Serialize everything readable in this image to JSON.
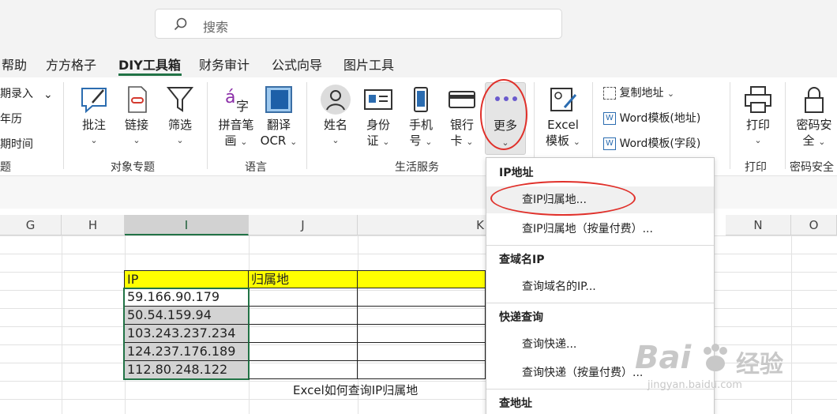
{
  "search": {
    "placeholder": "搜索"
  },
  "tabs": [
    {
      "label": "帮助"
    },
    {
      "label": "方方格子"
    },
    {
      "label": "DIY工具箱"
    },
    {
      "label": "财务审计"
    },
    {
      "label": "公式向导"
    },
    {
      "label": "图片工具"
    }
  ],
  "active_tab": "DIY工具箱",
  "ribbon": {
    "partial_items": [
      "期录入",
      "年历",
      "期时间"
    ],
    "partial_group": "题",
    "btn_comment": "批注",
    "btn_link": "链接",
    "btn_filter": "筛选",
    "group_object": "对象专题",
    "btn_pinyin_1": "拼音笔",
    "btn_pinyin_2": "画",
    "btn_translate_1": "翻译",
    "btn_translate_2": "OCR",
    "group_language": "语言",
    "btn_name": "姓名",
    "btn_id_1": "身份",
    "btn_id_2": "证",
    "btn_phone_1": "手机",
    "btn_phone_2": "号",
    "btn_bank_1": "银行",
    "btn_bank_2": "卡",
    "btn_more": "更多",
    "group_life": "生活服务",
    "btn_excel_1": "Excel",
    "btn_excel_2": "模板",
    "copy_address": "复制地址",
    "word_tpl_address": "Word模板(地址)",
    "word_tpl_field": "Word模板(字段)",
    "btn_print": "打印",
    "group_print": "打印",
    "btn_password_1": "密码安",
    "btn_password_2": "全",
    "group_password": "密码安全"
  },
  "columns": [
    "G",
    "H",
    "I",
    "J",
    "K",
    "N",
    "O"
  ],
  "table": {
    "header_ip": "IP",
    "header_location": "归属地",
    "ips": [
      "59.166.90.179",
      "50.54.159.94",
      "103.243.237.234",
      "124.237.176.189",
      "112.80.248.122"
    ]
  },
  "caption": "Excel如何查询IP归属地",
  "menu": {
    "sections": [
      {
        "header": "IP地址",
        "items": [
          "查IP归属地...",
          "查IP归属地（按量付费）..."
        ]
      },
      {
        "header": "查域名IP",
        "items": [
          "查询域名的IP..."
        ]
      },
      {
        "header": "快递查询",
        "items": [
          "查询快递...",
          "查询快递（按量付费）..."
        ]
      },
      {
        "header": "查地址",
        "items": []
      }
    ]
  },
  "watermark": {
    "brand": "Bai",
    "brand_cn": "经验",
    "url": "jingyan.baidu.com"
  },
  "colors": {
    "accent": "#217346",
    "highlight": "#ffff00",
    "annotation": "#e0302a"
  }
}
